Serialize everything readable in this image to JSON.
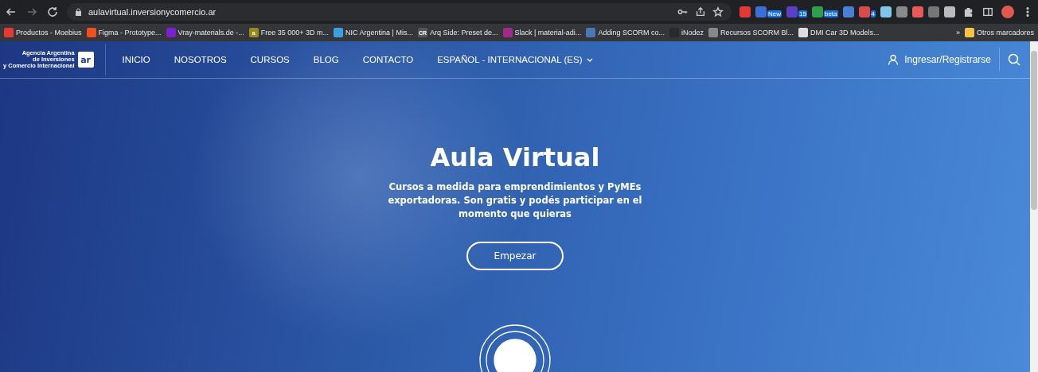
{
  "browser": {
    "url": "aulavirtual.inversionycomercio.ar",
    "extensions": [
      {
        "color": "#e53935"
      },
      {
        "color": "#3b6fd6",
        "badge": "New"
      },
      {
        "color": "#5b3fc4",
        "badge": "15"
      },
      {
        "color": "#2e9e4f",
        "badge": "beta"
      },
      {
        "color": "#4a7fd9"
      },
      {
        "color": "#d94a4a",
        "badge": "4"
      },
      {
        "color": "#7fc6e8"
      },
      {
        "color": "#8a8a8a"
      },
      {
        "color": "#e85a5a"
      },
      {
        "color": "#777777"
      },
      {
        "color": "#bbbbbb"
      }
    ],
    "bookmarks": [
      {
        "label": "Productos - Moebius",
        "color": "#e53935"
      },
      {
        "label": "Figma - Prototype...",
        "color": "#f24e1e"
      },
      {
        "label": "Vray-materials.de -...",
        "color": "#7a1fd1"
      },
      {
        "label": "Free 35 000+ 3D m...",
        "color": "#9a8a1c",
        "icon_text": "a"
      },
      {
        "label": "NIC Argentina | Mis...",
        "color": "#3aa0e0"
      },
      {
        "label": "Arq Side: Preset de...",
        "color": "#555555",
        "icon_text": "CR"
      },
      {
        "label": "Slack | material-adi...",
        "color": "#a02a8a"
      },
      {
        "label": "Adding SCORM co...",
        "color": "#4b79b8"
      },
      {
        "label": "iNodez",
        "color": "#2a2a2a"
      },
      {
        "label": "Recursos SCORM Bl...",
        "color": "#888888"
      },
      {
        "label": "DMI Car 3D Models...",
        "color": "#dddddd"
      }
    ],
    "more": "»",
    "other_bookmarks": "Otros marcadores"
  },
  "site": {
    "logo": {
      "lines": [
        "Agencia Argentina",
        "de Inversiones",
        "y Comercio Internacional"
      ],
      "mark": "ar"
    },
    "nav": [
      {
        "label": "INICIO"
      },
      {
        "label": "NOSOTROS"
      },
      {
        "label": "CURSOS"
      },
      {
        "label": "BLOG"
      },
      {
        "label": "CONTACTO"
      },
      {
        "label": "ESPAÑOL - INTERNACIONAL (ES)",
        "dropdown": true
      }
    ],
    "login": "Ingresar/Registrarse"
  },
  "hero": {
    "title": "Aula Virtual",
    "subtitle": "Cursos a medida para emprendimientos y PyMEs exportadoras. Son gratis y podés participar en el momento que quieras",
    "button": "Empezar"
  }
}
